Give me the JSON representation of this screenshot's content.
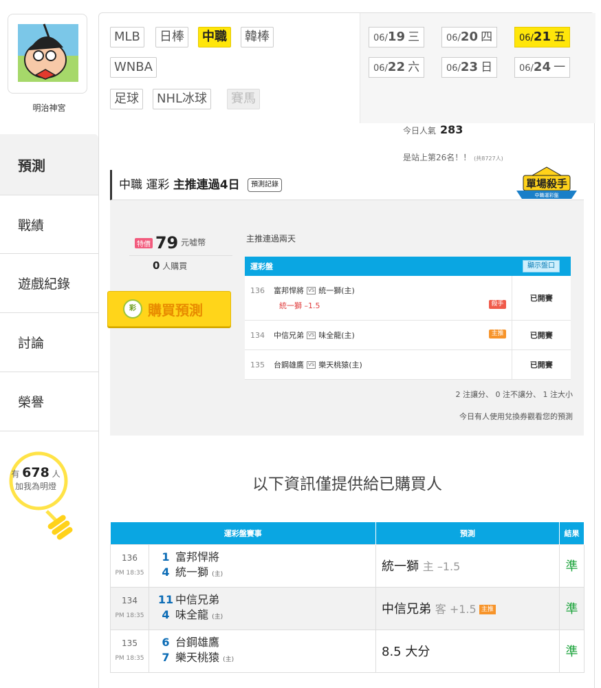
{
  "sidebar": {
    "user_name": "明治神宮",
    "tabs": {
      "predict": "預測",
      "record": "戰績",
      "history": "遊戲紀錄",
      "discuss": "討論",
      "honor": "榮譽"
    },
    "lamp": {
      "prefix": "有",
      "count": "678",
      "suffix": "人",
      "line2": "加我為明燈"
    }
  },
  "leagues": [
    "MLB",
    "日棒",
    "中職",
    "韓棒",
    "WNBA",
    "足球",
    "NHL冰球",
    "賽馬"
  ],
  "active_league": "中職",
  "dates": [
    {
      "m": "06/",
      "d": "19",
      "w": "三"
    },
    {
      "m": "06/",
      "d": "20",
      "w": "四"
    },
    {
      "m": "06/",
      "d": "21",
      "w": "五"
    },
    {
      "m": "06/",
      "d": "22",
      "w": "六"
    },
    {
      "m": "06/",
      "d": "23",
      "w": "日"
    },
    {
      "m": "06/",
      "d": "24",
      "w": "一"
    }
  ],
  "popularity": {
    "label": "今日人氣",
    "value": "283",
    "rank": "是站上第26名！！",
    "rank_small": "(共8727人)"
  },
  "prediction": {
    "header_prefix": "中職 運彩",
    "header_bold": "主推連過4日",
    "record_button": "預測記錄",
    "badge_text": "單場殺手",
    "badge_sub": "中職運彩盤",
    "price_tag": "特價",
    "price": "79",
    "price_unit": "元嘘幣",
    "buyers_count": "0",
    "buyers_label": "人購買",
    "buy_button": "購買預測",
    "buy_icon": "彩",
    "streak_note": "主推連過兩天",
    "table_title": "運彩盤",
    "show_button": "顯示盤口",
    "games": [
      {
        "num": "136",
        "away": "富邦悍將",
        "home": "統一獅(主)",
        "line": "統一獅 –1.5",
        "tag": "殺手",
        "tag_color": "red",
        "status": "已開賽"
      },
      {
        "num": "134",
        "away": "中信兄弟",
        "home": "味全龍(主)",
        "line": "",
        "tag": "主推",
        "tag_color": "orange",
        "status": "已開賽"
      },
      {
        "num": "135",
        "away": "台鋼雄鷹",
        "home": "樂天桃猿(主)",
        "line": "",
        "tag": "",
        "tag_color": "",
        "status": "已開賽"
      }
    ],
    "vs": "VS",
    "counts_note": "2 注讓分、 0 注不讓分、 1 注大小",
    "voucher_note": "今日有人使用兌換券觀看您的預測"
  },
  "buyer_only_note": "以下資訊僅提供給已購買人",
  "results": {
    "headers": [
      "運彩盤賽事",
      "預測",
      "結果"
    ],
    "rows": [
      {
        "num": "136",
        "time": "PM 18:35",
        "away_score": "1",
        "away": "富邦悍將",
        "home_score": "4",
        "home": "統一獅",
        "home_mark": "(主)",
        "pick": "統一獅",
        "pick_sub": "主 –1.5",
        "pick_tag": "",
        "outcome": "準"
      },
      {
        "num": "134",
        "time": "PM 18:35",
        "away_score": "11",
        "away": "中信兄弟",
        "home_score": "4",
        "home": "味全龍",
        "home_mark": "(主)",
        "pick": "中信兄弟",
        "pick_sub": "客 +1.5",
        "pick_tag": "主推",
        "outcome": "準"
      },
      {
        "num": "135",
        "time": "PM 18:35",
        "away_score": "6",
        "away": "台鋼雄鷹",
        "home_score": "7",
        "home": "樂天桃猿",
        "home_mark": "(主)",
        "pick": "8.5 大分",
        "pick_sub": "",
        "pick_tag": "",
        "outcome": "準"
      }
    ]
  }
}
